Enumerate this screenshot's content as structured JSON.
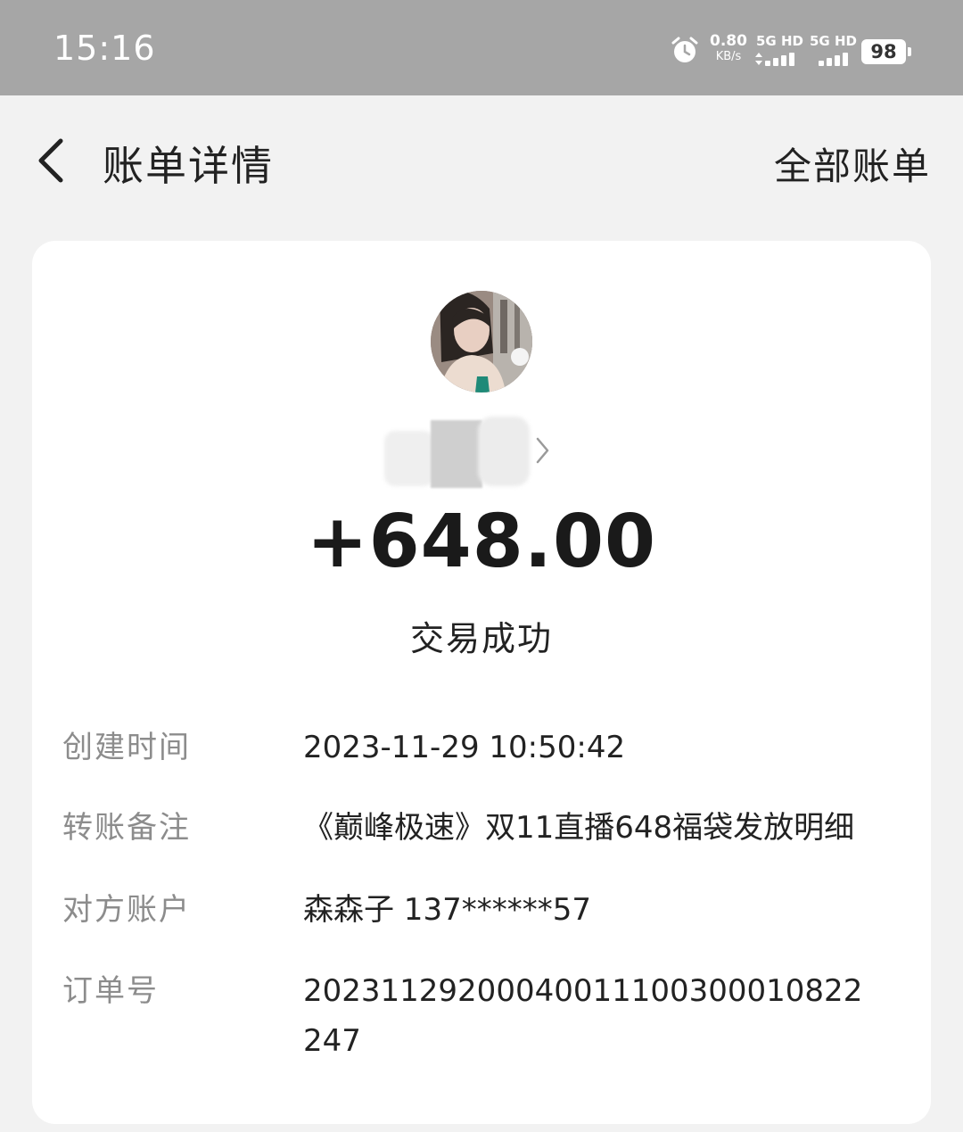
{
  "status_bar": {
    "time": "15:16",
    "net_speed_value": "0.80",
    "net_speed_unit": "KB/s",
    "sim1_label": "5G HD",
    "sim2_label": "5G HD",
    "battery": "98"
  },
  "nav": {
    "title": "账单详情",
    "all_bills": "全部账单"
  },
  "card": {
    "amount": "+648.00",
    "status": "交易成功",
    "details": [
      {
        "label": "创建时间",
        "value": "2023-11-29 10:50:42"
      },
      {
        "label": "转账备注",
        "value": "《巅峰极速》双11直播648福袋发放明细"
      },
      {
        "label": "对方账户",
        "value": "森森子 137******57"
      },
      {
        "label": "订单号",
        "value": "20231129200040011100300010822247"
      }
    ]
  }
}
